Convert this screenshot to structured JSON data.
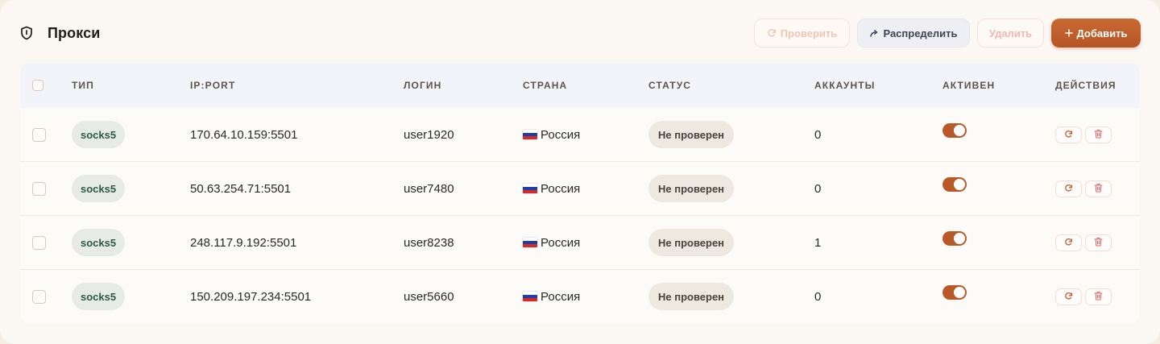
{
  "header": {
    "title": "Прокси",
    "buttons": {
      "check": "Проверить",
      "distribute": "Распределить",
      "delete": "Удалить",
      "add": "Добавить"
    }
  },
  "table": {
    "columns": {
      "type": "ТИП",
      "ip_port": "IP:PORT",
      "login": "ЛОГИН",
      "country": "СТРАНА",
      "status": "СТАТУС",
      "accounts": "АККАУНТЫ",
      "active": "АКТИВЕН",
      "actions": "ДЕЙСТВИЯ"
    },
    "rows": [
      {
        "type": "socks5",
        "ip_port": "170.64.10.159:5501",
        "login": "user1920",
        "country": "Россия",
        "status": "Не проверен",
        "accounts": "0",
        "active": true
      },
      {
        "type": "socks5",
        "ip_port": "50.63.254.71:5501",
        "login": "user7480",
        "country": "Россия",
        "status": "Не проверен",
        "accounts": "0",
        "active": true
      },
      {
        "type": "socks5",
        "ip_port": "248.117.9.192:5501",
        "login": "user8238",
        "country": "Россия",
        "status": "Не проверен",
        "accounts": "1",
        "active": true
      },
      {
        "type": "socks5",
        "ip_port": "150.209.197.234:5501",
        "login": "user5660",
        "country": "Россия",
        "status": "Не проверен",
        "accounts": "0",
        "active": true
      }
    ]
  },
  "icons": {
    "title": "shield-icon",
    "check": "refresh-icon",
    "distribute": "share-arrow-icon",
    "add": "plus-icon",
    "row_check": "refresh-icon",
    "row_delete": "trash-icon",
    "country_flag": "russia-flag-icon"
  },
  "colors": {
    "accent": "#b8592a",
    "type_pill_bg": "#e6ebe8",
    "type_pill_text": "#2e5a4c",
    "status_pill_bg": "#ede8e0",
    "delete_icon": "#e06a6a"
  }
}
